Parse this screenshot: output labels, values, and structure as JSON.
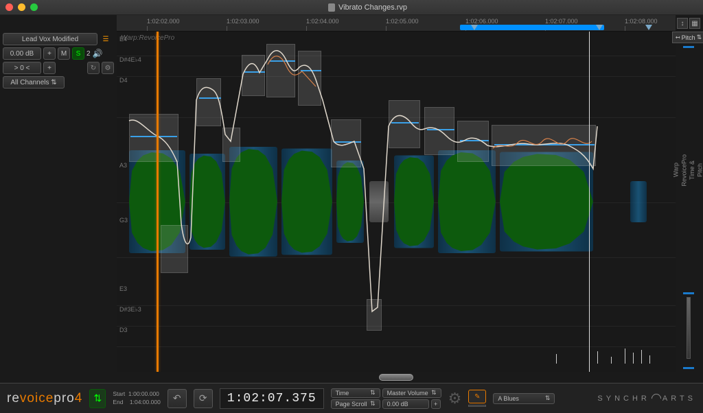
{
  "window": {
    "title": "Vibrato Changes.rvp"
  },
  "ruler": {
    "ticks": [
      "1:02:02.000",
      "1:02:03.000",
      "1:02:04.000",
      "1:02:05.000",
      "1:02:06.000",
      "1:02:07.000",
      "1:02:08.000"
    ]
  },
  "track_panel": {
    "name": "Lead Vox Modified",
    "gain": "0.00 dB",
    "pan": "> 0 <",
    "mute": "M",
    "solo": "S",
    "count": "2",
    "channels": "All Channels"
  },
  "main": {
    "process_label": "Warp:RevoicePro",
    "notes": [
      "E4",
      "D#4E♭4",
      "D4",
      "A3",
      "G3",
      "E3",
      "D#3E♭3",
      "D3"
    ]
  },
  "right": {
    "mode": "Pitch",
    "tooltip": "Warp\nRevoicePro\nTime &\nPitch"
  },
  "footer": {
    "brand_a": "re",
    "brand_b": "voice",
    "brand_c": "pro",
    "brand_v": "4",
    "start_label": "Start",
    "start_val": "1:00:00.000",
    "end_label": "End",
    "end_val": "1:04:00.000",
    "timecode": "1:02:07.375",
    "menu1": "Time",
    "menu2": "Master Volume",
    "menu3": "Page Scroll",
    "menu3v": "0.00 dB",
    "scale": "A Blues",
    "company": "SYNCHROARTS"
  }
}
